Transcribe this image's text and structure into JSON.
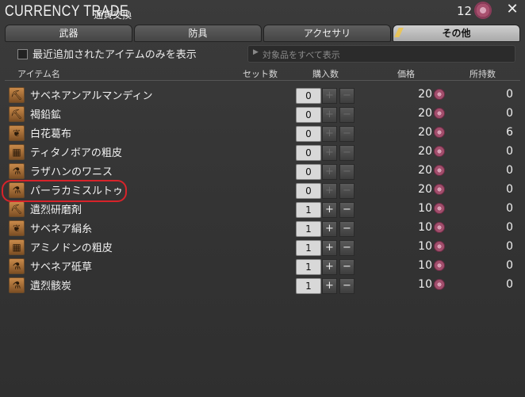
{
  "window": {
    "title": "CURRENCY TRADE",
    "subtitle": "通貨交換",
    "currency_count": "12",
    "close_icon": "crossed-tools-icon"
  },
  "tabs": [
    {
      "label": "武器",
      "active": false
    },
    {
      "label": "防具",
      "active": false
    },
    {
      "label": "アクセサリ",
      "active": false
    },
    {
      "label": "その他",
      "active": true
    }
  ],
  "filter": {
    "checkbox_label": "最近追加されたアイテムのみを表示",
    "show_all_label": "対象品をすべて表示"
  },
  "columns": {
    "name": "アイテム名",
    "set_count": "セット数",
    "purchase_count": "購入数",
    "price": "価格",
    "owned": "所持数"
  },
  "colors": {
    "accent_active_tab": "#b8b8b8",
    "highlight": "#d8232a",
    "currency": "#a24e6c"
  },
  "items": [
    {
      "name": "サベネアンアルマンディン",
      "icon": "pickaxe-icon",
      "qty": "0",
      "price": "20",
      "owned": "0"
    },
    {
      "name": "褐鉛鉱",
      "icon": "pickaxe-icon",
      "qty": "0",
      "price": "20",
      "owned": "0"
    },
    {
      "name": "白花葛布",
      "icon": "leaf-icon",
      "qty": "0",
      "price": "20",
      "owned": "6"
    },
    {
      "name": "ティタノボアの粗皮",
      "icon": "hide-icon",
      "qty": "0",
      "price": "20",
      "owned": "0"
    },
    {
      "name": "ラザハンのワニス",
      "icon": "flask-icon",
      "qty": "0",
      "price": "20",
      "owned": "0"
    },
    {
      "name": "パーラカミスルトゥ",
      "icon": "flask-icon",
      "qty": "0",
      "price": "20",
      "owned": "0"
    },
    {
      "name": "遺烈研磨剤",
      "icon": "pickaxe-icon",
      "qty": "1",
      "price": "10",
      "owned": "0"
    },
    {
      "name": "サベネア絹糸",
      "icon": "leaf-icon",
      "qty": "1",
      "price": "10",
      "owned": "0"
    },
    {
      "name": "アミノドンの粗皮",
      "icon": "hide-icon",
      "qty": "1",
      "price": "10",
      "owned": "0"
    },
    {
      "name": "サベネア砥草",
      "icon": "flask-icon",
      "qty": "1",
      "price": "10",
      "owned": "0"
    },
    {
      "name": "遺烈骸炭",
      "icon": "flask-icon",
      "qty": "1",
      "price": "10",
      "owned": "0"
    }
  ]
}
